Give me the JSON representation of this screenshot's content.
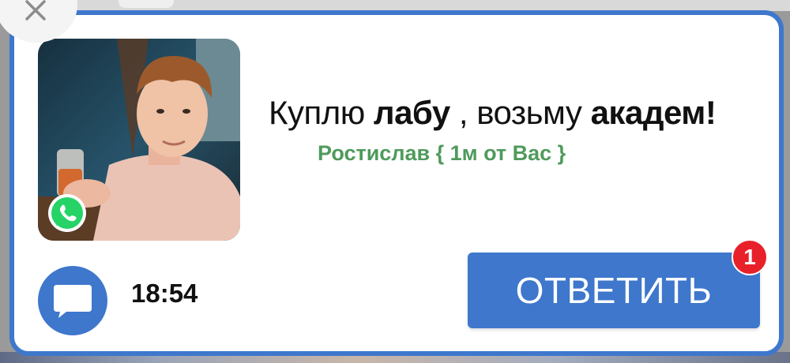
{
  "notification": {
    "message": {
      "part1": "Куплю ",
      "part2": "лабу",
      "part3": " , возьму ",
      "part4": "академ!"
    },
    "sender": "Ростислав { 1м от Вас }",
    "time": "18:54",
    "reply_label": "ОТВЕТИТЬ",
    "unread_count": "1"
  },
  "colors": {
    "accent": "#3e77cc",
    "sender_text": "#4f9a5b",
    "badge": "#e8202a",
    "whatsapp": "#25d366"
  },
  "icons": {
    "close": "close-icon",
    "whatsapp": "whatsapp-icon",
    "chat": "chat-bubble-icon"
  }
}
